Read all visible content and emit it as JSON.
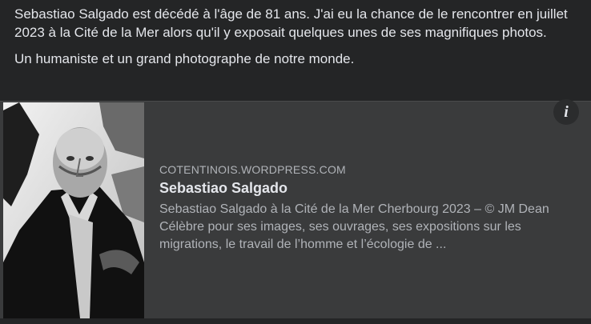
{
  "post": {
    "paragraphs": [
      "Sebastiao Salgado est décédé à l'âge de 81 ans. J'ai eu la chance de le rencontrer en juillet 2023 à la Cité de la Mer alors qu'il y exposait quelques unes de ses magnifiques photos.",
      "Un humaniste et un grand photographe de notre monde."
    ]
  },
  "link_card": {
    "domain": "COTENTINOIS.WORDPRESS.COM",
    "title": "Sebastiao Salgado",
    "description": "Sebastiao Salgado à la Cité de la Mer Cherbourg 2023 – © JM Dean Célèbre pour ses images, ses ouvrages, ses expositions sur les migrations, le travail de l’homme et l’écologie de ...",
    "info_icon": "i"
  },
  "colors": {
    "background": "#242526",
    "card_background": "#3a3b3c",
    "primary_text": "#e4e6eb",
    "secondary_text": "#b0b3b8"
  }
}
